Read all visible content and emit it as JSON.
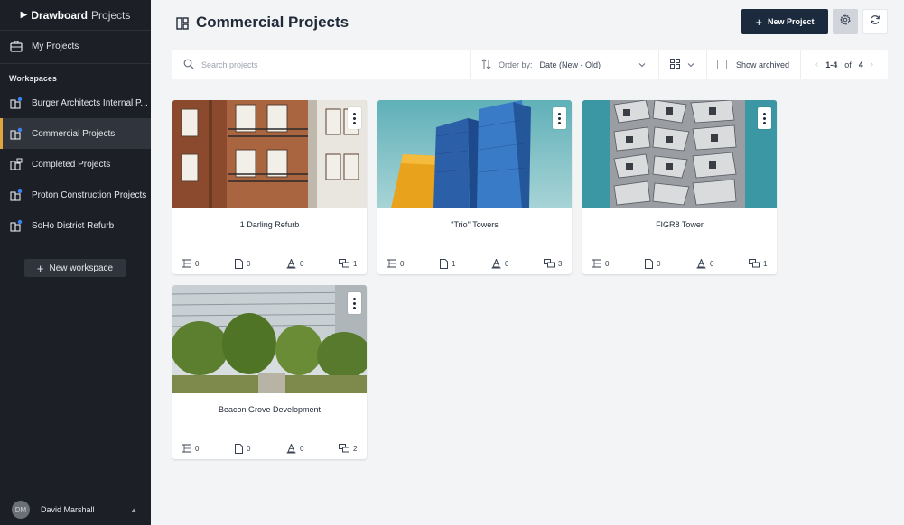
{
  "brand": {
    "name_bold": "Drawboard",
    "name_light": "Projects"
  },
  "sidebar": {
    "my_projects": "My Projects",
    "workspaces_label": "Workspaces",
    "workspaces": [
      {
        "label": "Burger Architects Internal P..."
      },
      {
        "label": "Commercial Projects",
        "active": true
      },
      {
        "label": "Completed Projects"
      },
      {
        "label": "Proton Construction Projects"
      },
      {
        "label": "SoHo District Refurb"
      }
    ],
    "new_workspace": "New workspace",
    "user": {
      "initials": "DM",
      "name": "David Marshall"
    }
  },
  "header": {
    "title": "Commercial Projects",
    "new_project": "New Project"
  },
  "toolbar": {
    "search_placeholder": "Search projects",
    "order_label": "Order by:",
    "order_value": "Date (New - Old)",
    "show_archived": "Show archived",
    "pagination": {
      "range": "1-4",
      "of": "of",
      "total": "4"
    }
  },
  "projects": [
    {
      "title": "1 Darling Refurb",
      "drawings": "0",
      "documents": "0",
      "issues": "0",
      "members": "1"
    },
    {
      "title": "\"Trio\" Towers",
      "drawings": "0",
      "documents": "1",
      "issues": "0",
      "members": "3"
    },
    {
      "title": "FIGR8 Tower",
      "drawings": "0",
      "documents": "0",
      "issues": "0",
      "members": "1"
    },
    {
      "title": "Beacon Grove Development",
      "drawings": "0",
      "documents": "0",
      "issues": "0",
      "members": "2"
    }
  ],
  "colors": {
    "sidebar_bg": "#1c1f26",
    "accent": "#e0a53c",
    "primary_button": "#1c2a3e"
  }
}
